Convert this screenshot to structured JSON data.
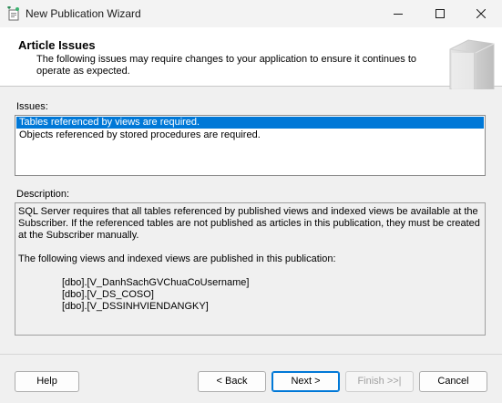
{
  "window": {
    "title": "New Publication Wizard"
  },
  "header": {
    "title": "Article Issues",
    "description": "The following issues may require changes to your application to ensure it continues to operate as expected."
  },
  "issues": {
    "label": "Issues:",
    "items": [
      {
        "text": "Tables referenced by views are required.",
        "selected": true
      },
      {
        "text": "Objects referenced by stored procedures are required.",
        "selected": false
      }
    ]
  },
  "description": {
    "label": "Description:",
    "paragraph1": "SQL Server requires that all tables referenced by published views and indexed views be available at the Subscriber. If the referenced tables are not published as articles in this publication, they must be created at the Subscriber manually.",
    "paragraph2": "The following views and indexed views are published in this publication:",
    "views": [
      "[dbo].[V_DanhSachGVChuaCoUsername]",
      "[dbo].[V_DS_COSO]",
      "[dbo].[V_DSSINHVIENDANGKY]"
    ]
  },
  "buttons": {
    "help": "Help",
    "back": "< Back",
    "next": "Next >",
    "finish": "Finish >>|",
    "cancel": "Cancel"
  },
  "icons": {
    "app": "wizard-app-icon",
    "header_graphic": "book-graphic-icon",
    "minimize": "minimize-icon",
    "maximize": "maximize-icon",
    "close": "close-icon"
  },
  "colors": {
    "selection": "#0078d7",
    "window_bg": "#f0f0f0",
    "header_bg": "#ffffff"
  }
}
